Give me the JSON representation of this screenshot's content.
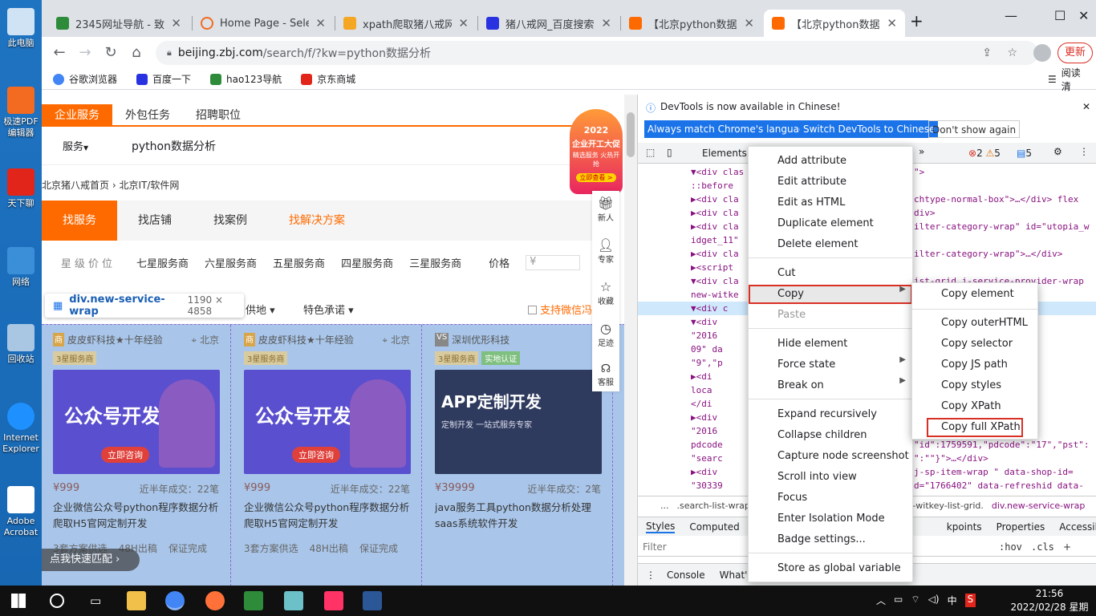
{
  "desktop": {
    "icons": [
      {
        "label": "此电脑"
      },
      {
        "label": "极速PDF编辑器"
      },
      {
        "label": "天下聊"
      },
      {
        "label": "网络"
      },
      {
        "label": "回收站"
      },
      {
        "label": "Internet Explorer"
      },
      {
        "label": "Adobe Acrobat"
      }
    ]
  },
  "browser": {
    "tabs": [
      {
        "title": "2345网址导航 - 致力",
        "favicon": "2345",
        "color": "#2e8b3a"
      },
      {
        "title": "Home Page - Selec",
        "favicon": "home-arc",
        "color": "#f26b21"
      },
      {
        "title": "xpath爬取猪八戒网",
        "favicon": "doc",
        "color": "#f5a623"
      },
      {
        "title": "猪八戒网_百度搜索",
        "favicon": "paw",
        "color": "#2932e1"
      },
      {
        "title": "【北京python数据分",
        "favicon": "zbj",
        "color": "#ff6a00"
      },
      {
        "title": "【北京python数据分",
        "favicon": "zbj",
        "color": "#ff6a00"
      }
    ],
    "new_tab": "+",
    "url_host": "beijing.zbj.com",
    "url_path": "/search/f/?kw=python数据分析",
    "update_label": "更新",
    "bookmarks": [
      {
        "label": "谷歌浏览器",
        "color": "#4285f4"
      },
      {
        "label": "百度一下",
        "color": "#2932e1"
      },
      {
        "label": "hao123导航",
        "color": "#2e8b3a"
      },
      {
        "label": "京东商城",
        "color": "#e1251b"
      }
    ],
    "reading_list": "阅读清"
  },
  "page": {
    "topnav": [
      "企业服务",
      "外包任务",
      "招聘职位"
    ],
    "service_dropdown": "服务",
    "search_query": "python数据分析",
    "breadcrumb": [
      "北京猪八戒首页",
      "北京IT/软件网"
    ],
    "menu": [
      "找服务",
      "找店铺",
      "找案例",
      "找解决方案"
    ],
    "star_label": "星级价位",
    "stars": [
      "七星服务商",
      "六星服务商",
      "五星服务商",
      "四星服务商",
      "三星服务商"
    ],
    "price_label": "价格",
    "price_placeholder": "¥",
    "filters": [
      "供地",
      "特色承诺"
    ],
    "wechat_pay": "支持微信冯",
    "tooltip_tag": "div.new-service-wrap",
    "tooltip_size": "1190 × 4858",
    "promo": {
      "year": "2022",
      "line1": "企业开工大促",
      "line2": "精选服务 火热开抢",
      "cta": "立即查看 >"
    },
    "side": [
      "新人",
      "专家",
      "收藏",
      "足迹",
      "客服"
    ],
    "match_btn": "点我快速匹配",
    "cards": [
      {
        "shop": "皮皮虾科技★十年经验",
        "loc": "北京",
        "badge": "3星服务商",
        "img_text": "公众号开发",
        "img_sub": "立即咨询",
        "price": "¥999",
        "deal": "近半年成交：22笔",
        "title": "企业微信公众号python程序数据分析爬取H5官网定制开发",
        "tags": [
          "3套方案供选",
          "48H出稿",
          "保证完成"
        ]
      },
      {
        "shop": "皮皮虾科技★十年经验",
        "loc": "北京",
        "badge": "3星服务商",
        "img_text": "公众号开发",
        "img_sub": "立即咨询",
        "price": "¥999",
        "deal": "近半年成交：22笔",
        "title": "企业微信公众号python程序数据分析爬取H5官网定制开发",
        "tags": [
          "3套方案供选",
          "48H出稿",
          "保证完成"
        ]
      },
      {
        "shop": "深圳优形科技",
        "loc": "",
        "badge": "3星服务商",
        "badge2": "实地认证",
        "img_text": "APP定制开发",
        "img_sub": "定制开发 一站式服务专家",
        "price": "¥39999",
        "deal": "近半年成交：2笔",
        "title": "java服务工具python数据分析处理saas系统软件开发",
        "tags": []
      }
    ]
  },
  "devtools": {
    "notice": "DevTools is now available in Chinese!",
    "btn_match": "Always match Chrome's language",
    "btn_switch": "Switch DevTools to Chinese",
    "btn_dont": "Don't show again",
    "tab_elements": "Elements",
    "errors": "2",
    "warnings": "5",
    "messages": "5",
    "dom_lines": [
      "▼<div clas",
      "  ::before",
      " ▶<div cla",
      " ▶<div cla",
      " ▶<div cla",
      "idget_11\"",
      " ▶<div cla",
      " ▶<script",
      " ▼<div cla",
      "new-witke",
      "   ▼<div c",
      "    ▼<div",
      "     \"2016",
      "     09\" da",
      "     \"9\",\"p",
      "      ▶<di",
      "       loca",
      "       </di",
      "    ▶<div",
      "     \"2016",
      "     pdcode",
      "     \"searc",
      "    ▶<div",
      "     \"30339",
      "     pdcode"
    ],
    "dom_right": [
      "\">",
      "",
      "chtype-normal-box\">…</div> flex",
      "div>",
      "ilter-category-wrap\" id=\"utopia_w",
      "",
      "ilter-category-wrap\">…</div>",
      "",
      "ist-grid j-service-provider-wrap",
      "",
      "",
      "a-shop-id=",
      "eshid=\"70886",
      "odcode\":",
      "",
      "ata-",
      "div>",
      "",
      "a-shop-id=",
      "eshid data-",
      "\"id\":1759591,\"pdcode\":\"17\",\"pst\":",
      "\":\"\"}\">…</div>",
      "j-sp-item-wrap  \" data-shop-id=",
      "d=\"1766402\" data-refreshid data-",
      "\"id\":1766402,\"pdcode\":\"17\",\"pst\":"
    ],
    "crumbs": [
      "...",
      ".search-list-wrap.witk",
      "v-witkey-list-grid.",
      "div.new-service-wrap"
    ],
    "styles_tabs": [
      "Styles",
      "Computed",
      "kpoints",
      "Properties",
      "Accessibility"
    ],
    "filter_placeholder": "Filter",
    "filter_hov": ":hov",
    "filter_cls": ".cls",
    "drawer_tabs": [
      "Console",
      "What's"
    ]
  },
  "context_menu": [
    "Add attribute",
    "Edit attribute",
    "Edit as HTML",
    "Duplicate element",
    "Delete element",
    "Cut",
    "Copy",
    "Paste",
    "Hide element",
    "Force state",
    "Break on",
    "Expand recursively",
    "Collapse children",
    "Capture node screenshot",
    "Scroll into view",
    "Focus",
    "Enter Isolation Mode",
    "Badge settings...",
    "Store as global variable"
  ],
  "copy_submenu": [
    "Copy element",
    "Copy outerHTML",
    "Copy selector",
    "Copy JS path",
    "Copy styles",
    "Copy XPath",
    "Copy full XPath"
  ],
  "taskbar": {
    "time": "21:56",
    "date": "2022/02/28 星期一",
    "ime": "中"
  }
}
